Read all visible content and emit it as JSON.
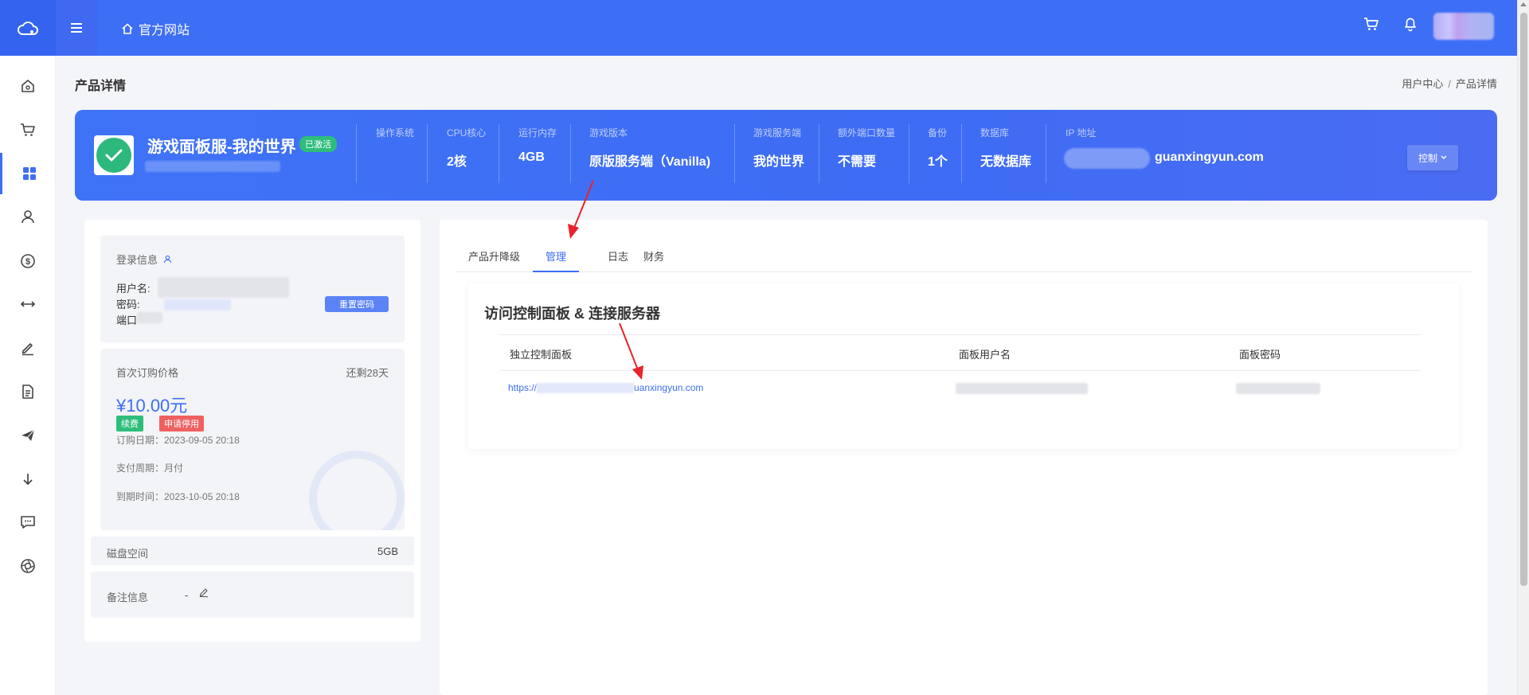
{
  "topbar": {
    "home_label": "官方网站"
  },
  "page": {
    "title": "产品详情",
    "breadcrumb": [
      "用户中心",
      "产品详情"
    ]
  },
  "product": {
    "name": "游戏面板服-我的世界",
    "status": "已激活",
    "specs": [
      {
        "label": "操作系统",
        "value": ""
      },
      {
        "label": "CPU核心",
        "value": "2核"
      },
      {
        "label": "运行内存",
        "value": "4GB"
      },
      {
        "label": "游戏版本",
        "value": "原版服务端（Vanilla)"
      },
      {
        "label": "游戏服务端",
        "value": "我的世界"
      },
      {
        "label": "额外端口数量",
        "value": "不需要"
      },
      {
        "label": "备份",
        "value": "1个"
      },
      {
        "label": "数据库",
        "value": "无数据库"
      },
      {
        "label": "IP 地址",
        "value": "guanxingyun.com"
      }
    ],
    "control_label": "控制"
  },
  "login": {
    "title": "登录信息",
    "username_label": "用户名:",
    "password_label": "密码:",
    "port_label": "端口",
    "reset_label": "重置密码"
  },
  "billing": {
    "first_price_label": "首次订购价格",
    "remaining": "还剩28天",
    "price": "¥10.00元",
    "renew_label": "续费",
    "stop_label": "申请停用",
    "order_date": "订购日期：2023-09-05 20:18",
    "cycle": "支付周期：月付",
    "expire": "到期时间：2023-10-05 20:18"
  },
  "disk": {
    "label": "磁盘空间",
    "value": "5GB"
  },
  "note": {
    "label": "备注信息",
    "value": "-"
  },
  "tabs": [
    "产品升降级",
    "管理",
    "日志",
    "财务"
  ],
  "manage": {
    "title": "访问控制面板 & 连接服务器",
    "columns": [
      "独立控制面板",
      "面板用户名",
      "面板密码"
    ],
    "url_prefix": "https://",
    "url_suffix": "uanxingyun.com"
  },
  "colors": {
    "primary": "#3d6ef6",
    "success": "#2ebd7b",
    "danger": "#f06060",
    "annotation": "#e8232a"
  },
  "icons": {
    "sidebar": [
      "home-icon",
      "cart-icon",
      "grid-icon",
      "user-icon",
      "dollar-icon",
      "transfer-icon",
      "edit-icon",
      "document-icon",
      "send-icon",
      "download-icon",
      "chat-icon",
      "aperture-icon"
    ]
  }
}
